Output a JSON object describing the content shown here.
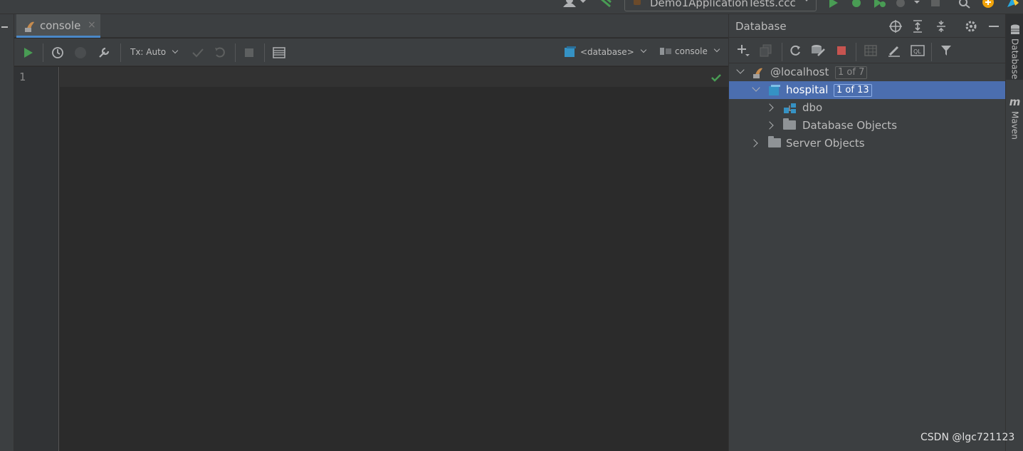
{
  "run_config": {
    "label": "Demo1ApplicationTests.ccc"
  },
  "editor_tab": {
    "label": "console",
    "close": "×"
  },
  "editor_toolbar": {
    "tx_mode": "Tx: Auto",
    "database_selector": "<database>",
    "console_selector": "console"
  },
  "editor": {
    "line_numbers": [
      "1"
    ]
  },
  "database_panel": {
    "title": "Database",
    "tree": [
      {
        "label": "@localhost",
        "badge": "1 of 7",
        "expanded": true,
        "selected": false
      },
      {
        "label": "hospital",
        "badge": "1 of 13",
        "expanded": true,
        "selected": true
      },
      {
        "label": "dbo",
        "expanded": false,
        "selected": false
      },
      {
        "label": "Database Objects",
        "expanded": false,
        "selected": false
      },
      {
        "label": "Server Objects",
        "expanded": false,
        "selected": false
      }
    ]
  },
  "right_tool_windows": [
    {
      "label": "Database",
      "active": true
    },
    {
      "label": "Maven",
      "active": false
    }
  ],
  "watermark": "CSDN @lgc721123",
  "colors": {
    "accent_run": "#499c54",
    "selection": "#4b6eaf",
    "stop_red": "#c75450",
    "db_blue": "#3592c4"
  }
}
